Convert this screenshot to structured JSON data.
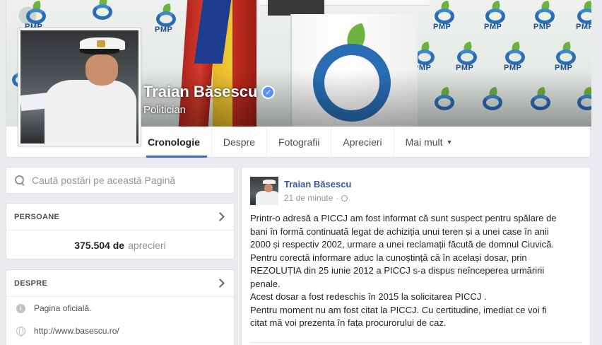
{
  "page": {
    "name": "Traian Băsescu",
    "category": "Politician",
    "verified_mark": "✓",
    "cover_logo_text": "PMP"
  },
  "tabs": [
    {
      "label": "Cronologie",
      "active": true
    },
    {
      "label": "Despre"
    },
    {
      "label": "Fotografii"
    },
    {
      "label": "Aprecieri"
    },
    {
      "label": "Mai mult",
      "caret": "▼"
    }
  ],
  "search": {
    "placeholder": "Caută postări pe această Pagină"
  },
  "people": {
    "title": "PERSOANE",
    "likes_count": "375.504 de",
    "likes_label": "aprecieri"
  },
  "about": {
    "title": "DESPRE",
    "official_label": "Pagina oficială.",
    "official_icon_glyph": "i",
    "website": "http://www.basescu.ro/"
  },
  "post": {
    "author": "Traian Băsescu",
    "time": "21 de minute",
    "dot": "·",
    "lines": [
      "Printr-o adresă a PICCJ am fost informat că sunt suspect pentru spălare de",
      "bani în formă continuată legat de achiziția unui teren și a unei case în anii",
      "2000 și respectiv 2002, urmare a unei reclamații făcută de domnul Ciuvică.",
      "Pentru corectă informare aduc la cunoștință că în același dosar, prin",
      "REZOLUȚIA din 25 iunie 2012 a PICCJ s-a dispus neînceperea urmăririi",
      "penale.",
      "Acest dosar a fost redeschis în 2015 la solicitarea PICCJ .",
      "Pentru moment nu am fost citat la PICCJ. Cu certitudine, imediat ce voi fi",
      "citat mă voi prezenta în fața procurorului de caz."
    ]
  }
}
